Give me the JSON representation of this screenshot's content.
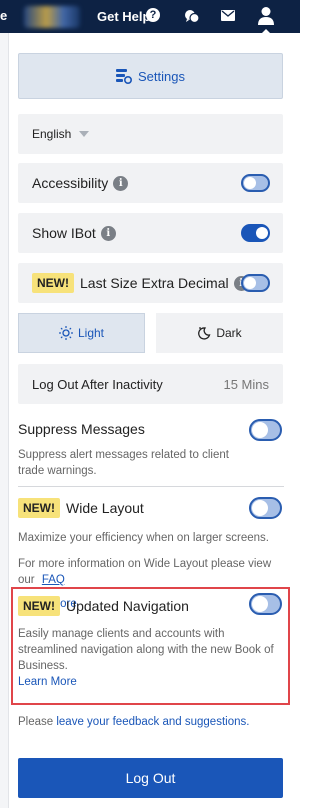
{
  "topbar": {
    "edge_char": "e",
    "get_help": "Get Help",
    "help_glyph": "?",
    "icons": [
      "question-circle-icon",
      "chat-icon",
      "mail-icon",
      "user-icon"
    ]
  },
  "settings": {
    "label": "Settings"
  },
  "language": {
    "selected": "English"
  },
  "accessibility": {
    "label": "Accessibility",
    "info": "i",
    "enabled": false
  },
  "show_ibot": {
    "label": "Show IBot",
    "info": "i",
    "enabled": true
  },
  "last_size": {
    "badge": "NEW!",
    "label": "Last Size Extra Decimal",
    "info": "i",
    "enabled": false
  },
  "theme": {
    "light": "Light",
    "dark": "Dark",
    "selected": "Light"
  },
  "inactivity": {
    "label": "Log Out After Inactivity",
    "value": "15 Mins"
  },
  "suppress": {
    "label": "Suppress Messages",
    "desc": "Suppress alert messages related to client trade warnings.",
    "enabled": false
  },
  "wide_layout": {
    "badge": "NEW!",
    "label": "Wide Layout",
    "desc": "Maximize your efficiency when on larger screens.",
    "more_text": "For more information on Wide Layout please view our",
    "faq": "FAQ",
    "learn_more": "Learn More",
    "enabled": false
  },
  "updated_nav": {
    "badge": "NEW!",
    "label": "Updated Navigation",
    "desc": "Easily manage clients and accounts with streamlined navigation along with the new Book of Business.",
    "learn_more": "Learn More",
    "enabled": false
  },
  "feedback": {
    "prefix": "Please ",
    "link": "leave your feedback and suggestions."
  },
  "logout_button": "Log Out",
  "colors": {
    "accent": "#1a56b8",
    "topbar": "#0d2244",
    "badge": "#f7e27a",
    "highlight": "#e0454a"
  }
}
